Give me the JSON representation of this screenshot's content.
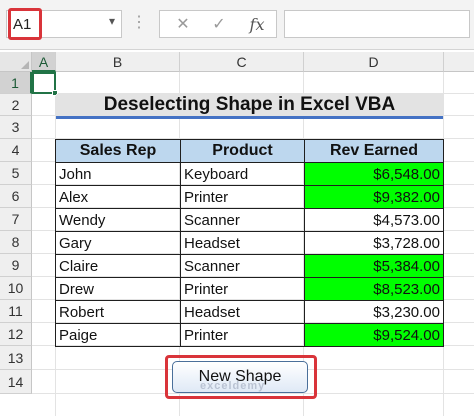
{
  "formula_bar": {
    "name_box_value": "A1",
    "name_box_arrow_icon": "chevron-down-icon",
    "more_icon": "vertical-dots-icon",
    "cancel_symbol": "✕",
    "enter_symbol": "✓",
    "fx_symbol": "fx",
    "formula_value": ""
  },
  "columns": [
    "A",
    "B",
    "C",
    "D"
  ],
  "rows": [
    "1",
    "2",
    "3",
    "4",
    "5",
    "6",
    "7",
    "8",
    "9",
    "10",
    "11",
    "12",
    "13",
    "14"
  ],
  "title": "Deselecting Shape in Excel VBA",
  "table": {
    "headers": [
      "Sales Rep",
      "Product",
      "Rev Earned"
    ],
    "rows": [
      {
        "rep": "John",
        "product": "Keyboard",
        "rev": "$6,548.00",
        "highlight": true
      },
      {
        "rep": "Alex",
        "product": "Printer",
        "rev": "$9,382.00",
        "highlight": true
      },
      {
        "rep": "Wendy",
        "product": "Scanner",
        "rev": "$4,573.00",
        "highlight": false
      },
      {
        "rep": "Gary",
        "product": "Headset",
        "rev": "$3,728.00",
        "highlight": false
      },
      {
        "rep": "Claire",
        "product": "Scanner",
        "rev": "$5,384.00",
        "highlight": true
      },
      {
        "rep": "Drew",
        "product": "Printer",
        "rev": "$8,523.00",
        "highlight": true
      },
      {
        "rep": "Robert",
        "product": "Headset",
        "rev": "$3,230.00",
        "highlight": false
      },
      {
        "rep": "Paige",
        "product": "Printer",
        "rev": "$9,524.00",
        "highlight": true
      }
    ]
  },
  "shape_button": {
    "label": "New Shape"
  },
  "watermark": "exceldemy",
  "colors": {
    "highlight_green": "#00ff00",
    "header_blue": "#bdd7ee",
    "annotation_red": "#d9343a",
    "selection_green": "#217346",
    "title_underline": "#4472c4"
  }
}
